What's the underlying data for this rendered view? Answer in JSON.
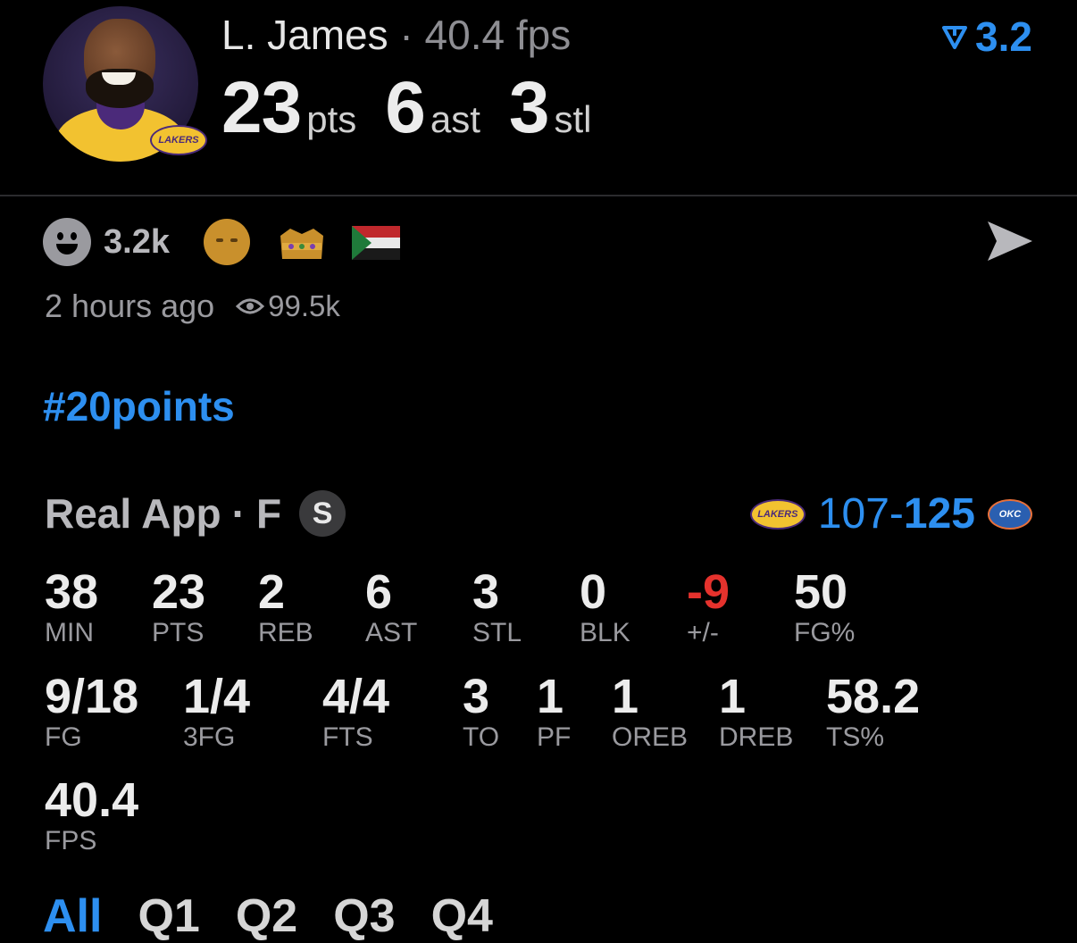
{
  "player": {
    "name": "L. James",
    "separator": "·",
    "fps_label": "40.4 fps",
    "headline": [
      {
        "value": "23",
        "unit": "pts"
      },
      {
        "value": "6",
        "unit": "ast"
      },
      {
        "value": "3",
        "unit": "stl"
      }
    ],
    "team_badge": "LAKERS"
  },
  "rating": {
    "value": "3.2",
    "icon": "triangle-down-icon",
    "color": "#2d8ff0"
  },
  "reactions": {
    "count": "3.2k",
    "icons": [
      "smiley-icon",
      "old-man-emoji",
      "crown-emoji",
      "sudan-flag-emoji"
    ]
  },
  "post": {
    "time_ago": "2 hours ago",
    "views": "99.5k",
    "hashtag": "#20points"
  },
  "game": {
    "source": "Real App",
    "separator": "·",
    "status": "F",
    "badge": "S",
    "home_team": "LAKERS",
    "away_team": "OKC",
    "score_home": "107",
    "score_dash": "-",
    "score_away": "125"
  },
  "stats_row1": [
    {
      "value": "38",
      "label": "MIN"
    },
    {
      "value": "23",
      "label": "PTS"
    },
    {
      "value": "2",
      "label": "REB"
    },
    {
      "value": "6",
      "label": "AST"
    },
    {
      "value": "3",
      "label": "STL"
    },
    {
      "value": "0",
      "label": "BLK"
    },
    {
      "value": "-9",
      "label": "+/-"
    },
    {
      "value": "50",
      "label": "FG%"
    }
  ],
  "stats_row2": [
    {
      "value": "9/18",
      "label": "FG"
    },
    {
      "value": "1/4",
      "label": "3FG"
    },
    {
      "value": "4/4",
      "label": "FTS"
    },
    {
      "value": "3",
      "label": "TO"
    },
    {
      "value": "1",
      "label": "PF"
    },
    {
      "value": "1",
      "label": "OREB"
    },
    {
      "value": "1",
      "label": "DREB"
    },
    {
      "value": "58.2",
      "label": "TS%"
    }
  ],
  "stats_row3": [
    {
      "value": "40.4",
      "label": "FPS"
    }
  ],
  "tabs": [
    "All",
    "Q1",
    "Q2",
    "Q3",
    "Q4"
  ],
  "colors": {
    "accent": "#2d8ff0",
    "negative": "#e5322d",
    "background": "#000000"
  }
}
